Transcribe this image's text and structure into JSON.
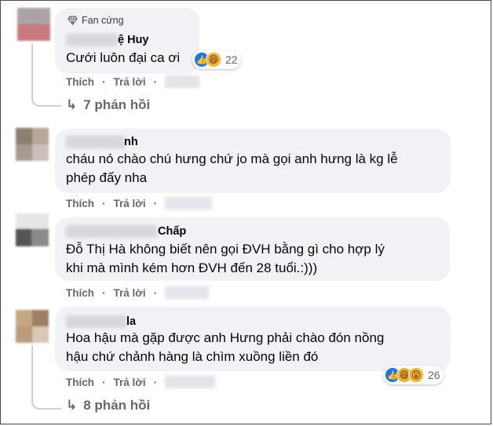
{
  "actions": {
    "like": "Thích",
    "reply": "Trả lời",
    "separator": "·"
  },
  "comments": [
    {
      "badge": "Fan cứng",
      "name_visible": "ệ Huy",
      "text": "Cưới luôn đại ca ơi",
      "reactions": {
        "types": [
          "like",
          "haha"
        ],
        "count": "22"
      },
      "replies": "7 phản hồi"
    },
    {
      "name_visible": "nh",
      "text_lines": [
        "cháu nó chào chú hưng chứ jo mà gọi anh hưng là kg lễ",
        "phép đấy nha"
      ]
    },
    {
      "name_visible": "Chấp",
      "text_lines": [
        "Đỗ Thị Hà không biết nên gọi ĐVH bằng gì cho hợp lý",
        "khi mà mình kém hơn ĐVH đến 28 tuổi.:)))"
      ]
    },
    {
      "name_visible": "la",
      "text_lines": [
        "Hoa hậu mà gặp được anh Hưng phải chào đón nồng",
        "hậu chứ chảnh hàng là chìm xuồng liền đó"
      ],
      "reactions": {
        "types": [
          "like",
          "haha",
          "wow"
        ],
        "count": "26"
      },
      "replies": "8 phản hồi"
    }
  ]
}
